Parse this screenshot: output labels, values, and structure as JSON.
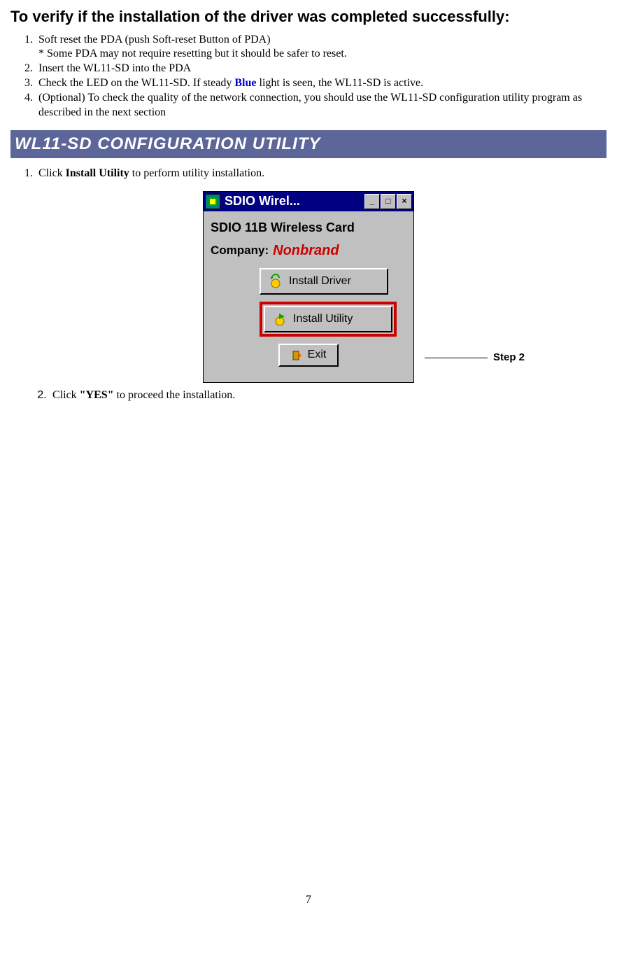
{
  "heading1": "To verify if the installation of the driver was completed successfully:",
  "verify_list": {
    "item1_line1": "Soft reset the PDA (push Soft-reset Button of PDA)",
    "item1_line2": "* Some PDA may not require resetting but it should be safer to reset.",
    "item2": "Insert the WL11-SD into the PDA",
    "item3_prefix": "Check the LED on the WL11-SD. If steady ",
    "item3_blue": "Blue",
    "item3_suffix": " light is seen, the WL11-SD is active.",
    "item4": "(Optional) To check the quality of the network connection, you should use the WL11-SD configuration utility program as described in the next section"
  },
  "section_header": "WL11-SD CONFIGURATION UTILITY",
  "config_list": {
    "item1_prefix": "Click ",
    "item1_bold": "Install Utility",
    "item1_suffix": " to perform utility installation.",
    "item2_prefix": "Click ",
    "item2_bold": "\"YES\"",
    "item2_suffix": " to proceed the installation."
  },
  "screenshot": {
    "title": "SDIO Wirel...",
    "heading": "SDIO 11B Wireless Card",
    "company_label": "Company:",
    "company_value": "Nonbrand",
    "btn_install_driver": "Install Driver",
    "btn_install_utility": "Install Utility",
    "btn_exit": "Exit"
  },
  "callout_label": "Step 2",
  "page_number": "7"
}
